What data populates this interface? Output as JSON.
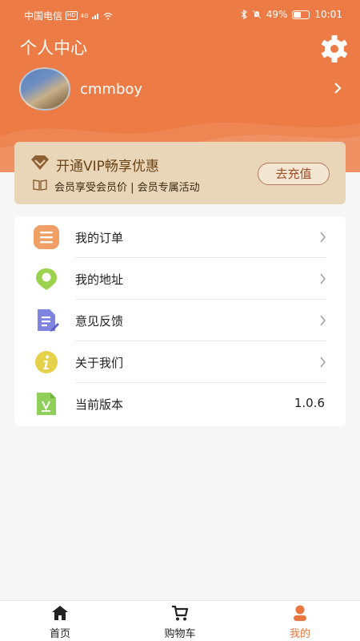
{
  "status_bar": {
    "carrier": "中国电信",
    "network_badge": "HD",
    "signal_text": "4G",
    "battery_text": "49%",
    "battery_level": 0.49,
    "time": "10:01"
  },
  "header": {
    "title": "个人中心",
    "settings_icon": "gear-icon"
  },
  "profile": {
    "username": "cmmboy"
  },
  "vip_card": {
    "title": "开通VIP畅享优惠",
    "subtitle": "会员享受会员价 | 会员专属活动",
    "button_label": "去充值"
  },
  "menu": {
    "items": [
      {
        "label": "我的订单",
        "icon": "list-icon"
      },
      {
        "label": "我的地址",
        "icon": "location-icon"
      },
      {
        "label": "意见反馈",
        "icon": "feedback-icon"
      },
      {
        "label": "关于我们",
        "icon": "info-icon"
      },
      {
        "label": "当前版本",
        "icon": "version-icon",
        "value": "1.0.6"
      }
    ]
  },
  "tabbar": {
    "tabs": [
      {
        "label": "首页",
        "icon": "home-icon"
      },
      {
        "label": "购物车",
        "icon": "cart-icon"
      },
      {
        "label": "我的",
        "icon": "user-icon",
        "active": true
      }
    ]
  },
  "colors": {
    "primary": "#ec7b45",
    "vip_bg": "#e9d6b8",
    "vip_text": "#6b4418",
    "active_tab": "#e8763e"
  }
}
